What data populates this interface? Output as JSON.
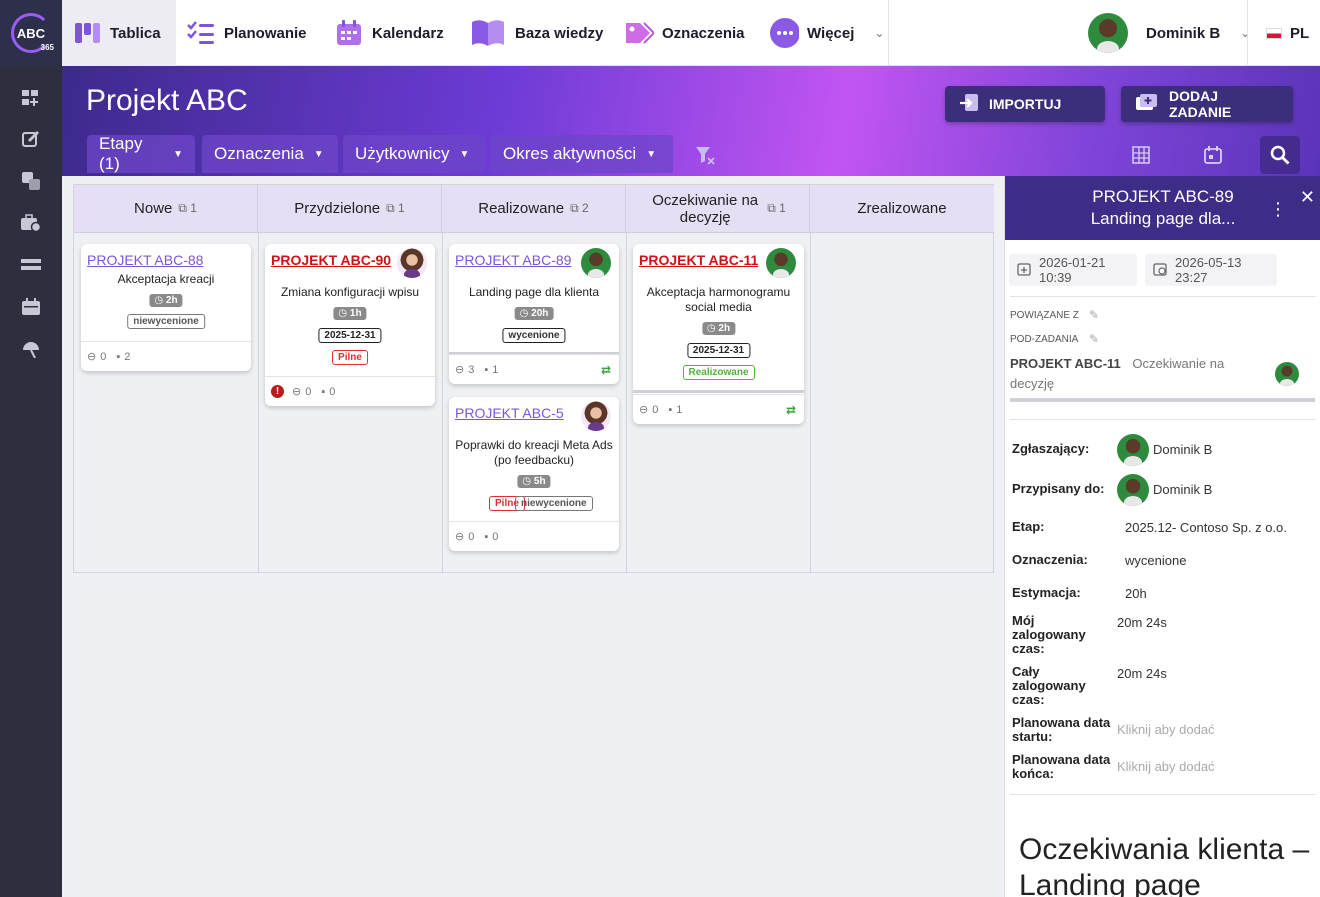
{
  "app": {
    "logo_text": "ABC",
    "logo_sub": "365"
  },
  "nav": {
    "items": [
      {
        "label": "Tablica"
      },
      {
        "label": "Planowanie"
      },
      {
        "label": "Kalendarz"
      },
      {
        "label": "Baza wiedzy"
      },
      {
        "label": "Oznaczenia"
      },
      {
        "label": "Więcej"
      }
    ],
    "user": "Dominik B",
    "lang": "PL"
  },
  "header": {
    "title": "Projekt ABC",
    "import_label": "IMPORTUJ",
    "add_label": "DODAJ ZADANIE",
    "filters": [
      "Etapy (1)",
      "Oznaczenia",
      "Użytkownicy",
      "Okres aktywności"
    ]
  },
  "columns": [
    {
      "title": "Nowe",
      "count": "1"
    },
    {
      "title": "Przydzielone",
      "count": "1"
    },
    {
      "title": "Realizowane",
      "count": "2"
    },
    {
      "title": "Oczekiwanie na decyzję",
      "count": "1"
    },
    {
      "title": "Zrealizowane",
      "count": ""
    }
  ],
  "cards": {
    "c88": {
      "id": "PROJEKT ABC-88",
      "title": "Akceptacja kreacji",
      "time": "2h",
      "tag": "niewycenione",
      "links": "0",
      "comments": "2"
    },
    "c90": {
      "id": "PROJEKT ABC-90",
      "title": "Zmiana konfiguracji wpisu",
      "time": "1h",
      "date": "2025-12-31",
      "tag": "Pilne",
      "links": "0",
      "comments": "0"
    },
    "c89": {
      "id": "PROJEKT ABC-89",
      "title": "Landing page dla klienta",
      "time": "20h",
      "tag": "wycenione",
      "links": "3",
      "comments": "1"
    },
    "c5": {
      "id": "PROJEKT ABC-5",
      "title": "Poprawki do kreacji Meta Ads (po feedbacku)",
      "time": "5h",
      "tag1": "Pilne",
      "tag2": "niewycenione",
      "links": "0",
      "comments": "0"
    },
    "c11": {
      "id": "PROJEKT ABC-11",
      "title": "Akceptacja harmonogramu social media",
      "time": "2h",
      "date": "2025-12-31",
      "tag": "Realizowane",
      "links": "0",
      "comments": "1"
    }
  },
  "panel": {
    "title1": "PROJEKT ABC-89",
    "title2": "Landing page dla...",
    "created": "2026-01-21 10:39",
    "due": "2026-05-13 23:27",
    "related_label": "POWIĄZANE Z",
    "subtasks_label": "POD-ZADANIA",
    "subtask_id": "PROJEKT ABC-11",
    "subtask_status": "Oczekiwanie na decyzję",
    "rows": {
      "reporter_l": "Zgłaszający:",
      "reporter_v": "Dominik B",
      "assignee_l": "Przypisany do:",
      "assignee_v": "Dominik B",
      "stage_l": "Etap:",
      "stage_v": "2025.12- Contoso Sp. z o.o.",
      "tags_l": "Oznaczenia:",
      "tags_v": "wycenione",
      "est_l": "Estymacja:",
      "est_v": "20h",
      "mytime_l": "Mój zalogowany czas:",
      "mytime_v": "20m 24s",
      "total_l": "Cały zalogowany czas:",
      "total_v": "20m 24s",
      "pstart_l": "Planowana data startu:",
      "pstart_v": "Kliknij aby dodać",
      "pend_l": "Planowana data końca:",
      "pend_v": "Kliknij aby dodać"
    },
    "desc": "Oczekiwania klienta – Landing page"
  },
  "colors": {
    "accent": "#7d55d8",
    "urgent": "#d0111a",
    "sidebar": "#2e2f3e",
    "header_dark": "#3f2c86"
  }
}
